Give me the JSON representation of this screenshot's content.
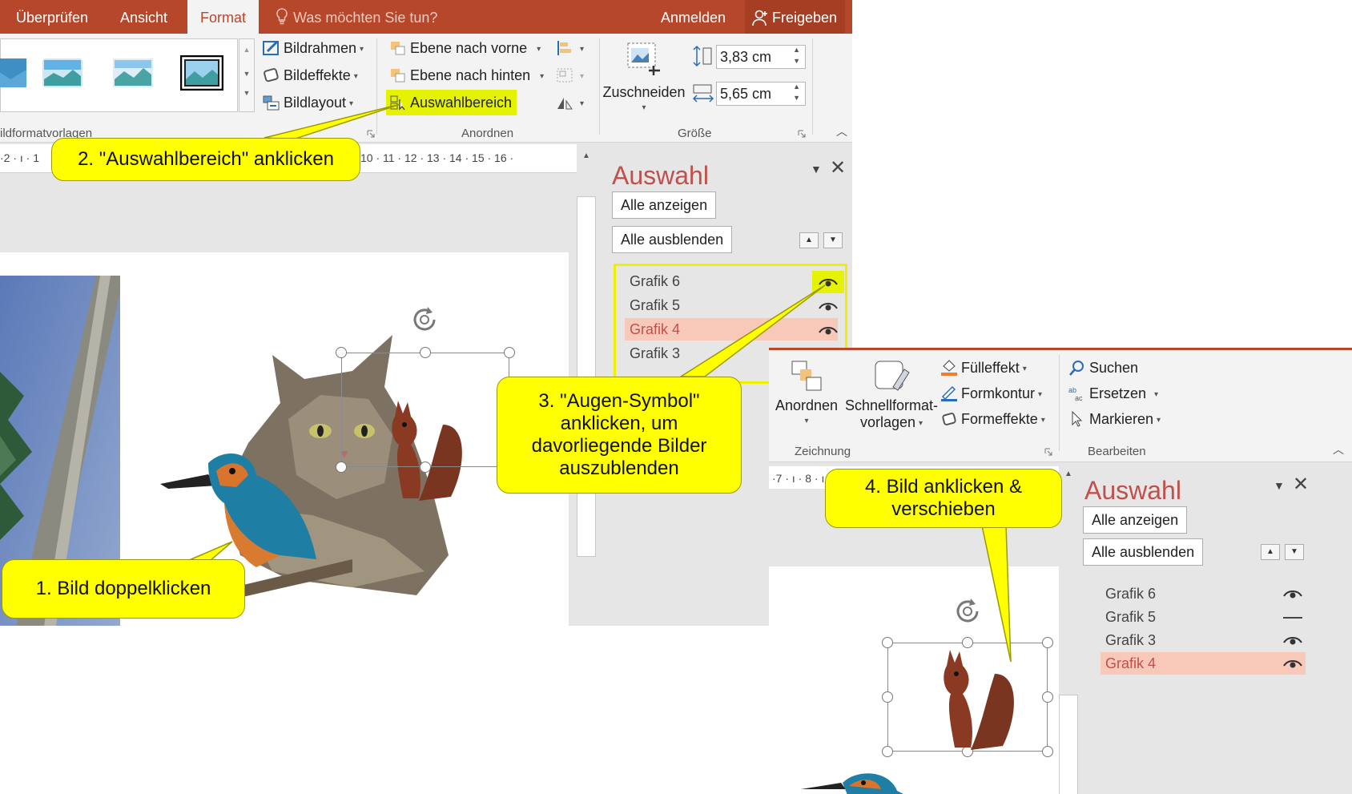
{
  "tabs": {
    "review": "Überprüfen",
    "view": "Ansicht",
    "format": "Format",
    "tell_me": "Was möchten Sie tun?",
    "signin": "Anmelden",
    "share": "Freigeben"
  },
  "ribbon1": {
    "picture_border": "Bildrahmen",
    "picture_effects": "Bildeffekte",
    "picture_layout": "Bildlayout",
    "bring_forward": "Ebene nach vorne",
    "send_backward": "Ebene nach hinten",
    "selection_pane": "Auswahlbereich",
    "crop": "Zuschneiden",
    "height_value": "3,83  cm",
    "width_value": "5,65  cm",
    "group_styles": "ildformatvorlagen",
    "group_arrange": "Anordnen",
    "group_size": "Größe"
  },
  "ruler1": {
    "left": "·2 · ı · 1",
    "right": "10 · 11 · 12 · 13 · 14 · 15 · 16 ·"
  },
  "pane1": {
    "title": "Auswahl",
    "show_all": "Alle anzeigen",
    "hide_all": "Alle ausblenden",
    "items": [
      "Grafik 6",
      "Grafik 5",
      "Grafik 4",
      "Grafik 3"
    ]
  },
  "ribbon2": {
    "arrange": "Anordnen",
    "quick_styles_1": "Schnellformat-",
    "quick_styles_2": "vorlagen",
    "fill": "Fülleffekt",
    "outline": "Formkontur",
    "effects": "Formeffekte",
    "find": "Suchen",
    "replace": "Ersetzen",
    "select": "Markieren",
    "group_drawing": "Zeichnung",
    "group_editing": "Bearbeiten"
  },
  "ruler2": "·7 · ı · 8 · ı ·",
  "pane2": {
    "title": "Auswahl",
    "show_all": "Alle anzeigen",
    "hide_all": "Alle ausblenden",
    "items": [
      "Grafik 6",
      "Grafik 5",
      "Grafik 3",
      "Grafik 4"
    ]
  },
  "callouts": {
    "step1": "1. Bild doppelklicken",
    "step2": "2. \"Auswahlbereich\" anklicken",
    "step3": "3. \"Augen-Symbol\" anklicken, um davorliegende Bilder auszublenden",
    "step4": "4. Bild anklicken & verschieben"
  },
  "colors": {
    "accent": "#b7472a",
    "pane_title": "#c0504d",
    "callout": "#ffff00",
    "selected_row": "#f8c9b9",
    "highlight": "#e5f200"
  }
}
